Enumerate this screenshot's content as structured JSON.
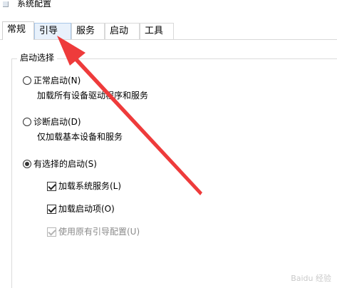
{
  "window": {
    "title": "系统配置"
  },
  "tabs": [
    {
      "label": "常规"
    },
    {
      "label": "引导"
    },
    {
      "label": "服务"
    },
    {
      "label": "启动"
    },
    {
      "label": "工具"
    }
  ],
  "group": {
    "legend": "启动选择"
  },
  "startup": {
    "normal": {
      "label": "正常启动(N)",
      "desc": "加载所有设备驱动程序和服务"
    },
    "diagnostic": {
      "label": "诊断启动(D)",
      "desc": "仅加载基本设备和服务"
    },
    "selective": {
      "label": "有选择的启动(S)",
      "load_system_services": "加载系统服务(L)",
      "load_startup_items": "加载启动项(O)",
      "use_original_boot": "使用原有引导配置(U)"
    }
  },
  "watermark": "Baidu 经验"
}
